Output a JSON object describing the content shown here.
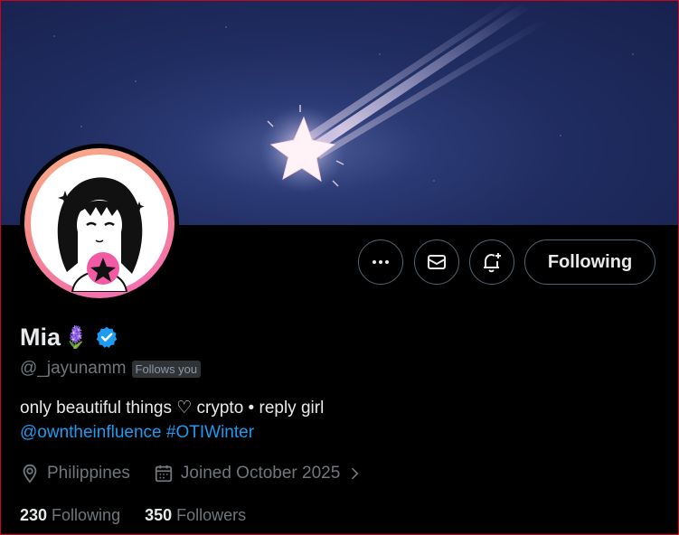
{
  "profile": {
    "name": "Mia",
    "name_emoji": "🪻",
    "handle": "@_jayunamm",
    "follows_you": "Follows you",
    "bio": "only beautiful things ♡ crypto • reply girl",
    "bio_mentions": [
      "@owntheinfluence",
      "#OTIWinter"
    ],
    "location": "Philippines",
    "joined": "Joined October 2025",
    "following_count": "230",
    "following_label": "Following",
    "followers_count": "350",
    "followers_label": "Followers",
    "verified_color": "#1d9bf0"
  },
  "actions": {
    "more_icon": "more-horizontal-icon",
    "message_icon": "envelope-icon",
    "notify_icon": "bell-plus-icon",
    "follow_label": "Following"
  },
  "colors": {
    "background": "#000000",
    "text": "#e7e9ea",
    "muted": "#71767b",
    "accent": "#1d9bf0",
    "banner": "#1f2c60"
  }
}
